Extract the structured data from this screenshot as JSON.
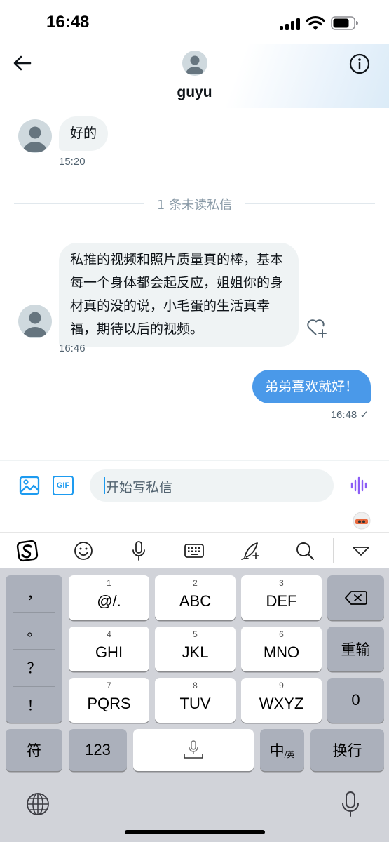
{
  "status_bar": {
    "time": "16:48"
  },
  "header": {
    "name": "guyu"
  },
  "messages": [
    {
      "text": "好的",
      "time": "15:20"
    },
    {
      "text": "私推的视频和照片质量真的棒，基本每一个身体都会起反应，姐姐你的身材真的没的说，小毛蛋的生活真幸福，期待以后的视频。",
      "time": "16:46"
    },
    {
      "text": "弟弟喜欢就好！",
      "time": "16:48 ✓"
    }
  ],
  "divider": {
    "text": "1 条未读私信"
  },
  "composer": {
    "placeholder": "开始写私信",
    "gif_label": "GIF"
  },
  "keyboard": {
    "punct": [
      "，",
      "。",
      "？",
      "！"
    ],
    "keys": [
      {
        "num": "1",
        "label": "@/."
      },
      {
        "num": "2",
        "label": "ABC"
      },
      {
        "num": "3",
        "label": "DEF"
      },
      {
        "num": "4",
        "label": "GHI"
      },
      {
        "num": "5",
        "label": "JKL"
      },
      {
        "num": "6",
        "label": "MNO"
      },
      {
        "num": "7",
        "label": "PQRS"
      },
      {
        "num": "8",
        "label": "TUV"
      },
      {
        "num": "9",
        "label": "WXYZ"
      }
    ],
    "reenter": "重输",
    "zero": "0",
    "symbols": "符",
    "numbers": "123",
    "lang_main": "中",
    "lang_sub": "/英",
    "newline": "换行"
  },
  "colors": {
    "accent": "#1d9bf0",
    "outgoing_bubble": "#4a99e9",
    "incoming_bubble": "#eff3f4",
    "keyboard_bg": "#d1d3d9"
  }
}
